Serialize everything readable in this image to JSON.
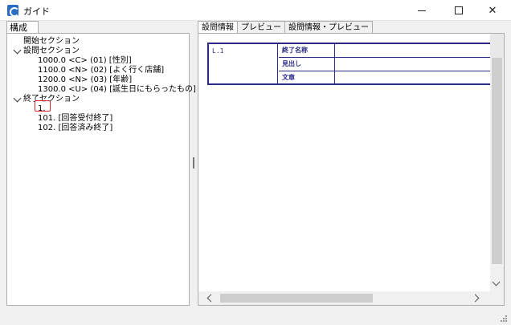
{
  "window": {
    "title": "ガイド"
  },
  "left_panel": {
    "tab_label": "構成",
    "tree": [
      {
        "label": "開始セクション",
        "level": 0,
        "expandable": false
      },
      {
        "label": "設問セクション",
        "level": 0,
        "expandable": true,
        "expanded": true
      },
      {
        "label": "1000.0 <C> (01) [性別]",
        "level": 1
      },
      {
        "label": "1100.0 <N> (02) [よく行く店舗]",
        "level": 1
      },
      {
        "label": "1200.0 <N> (03) [年齢]",
        "level": 1
      },
      {
        "label": "1300.0 <U> (04) [誕生日にもらったもの]",
        "level": 1
      },
      {
        "label": "終了セクション",
        "level": 0,
        "expandable": true,
        "expanded": true
      },
      {
        "label": "1.",
        "level": 1,
        "selected": true
      },
      {
        "label": "101. [回答受付終了]",
        "level": 1
      },
      {
        "label": "102. [回答済み終了]",
        "level": 1
      }
    ]
  },
  "right_panel": {
    "tabs": [
      {
        "label": "設問情報",
        "active": true
      },
      {
        "label": "プレビュー",
        "active": false
      },
      {
        "label": "設問情報・プレビュー",
        "active": false
      }
    ],
    "info_table": {
      "code": "L.1",
      "fields": [
        {
          "label": "終了名称",
          "value": ""
        },
        {
          "label": "見出し",
          "value": ""
        },
        {
          "label": "文章",
          "value": ""
        }
      ]
    }
  },
  "icons": {
    "app": "app-logo-icon",
    "minimize": "minimize-icon",
    "maximize": "maximize-icon",
    "close": "close-icon"
  },
  "colors": {
    "table_border": "#2a2a86",
    "selection_outline": "#e0262c",
    "app_icon": "#2b6cc4"
  }
}
